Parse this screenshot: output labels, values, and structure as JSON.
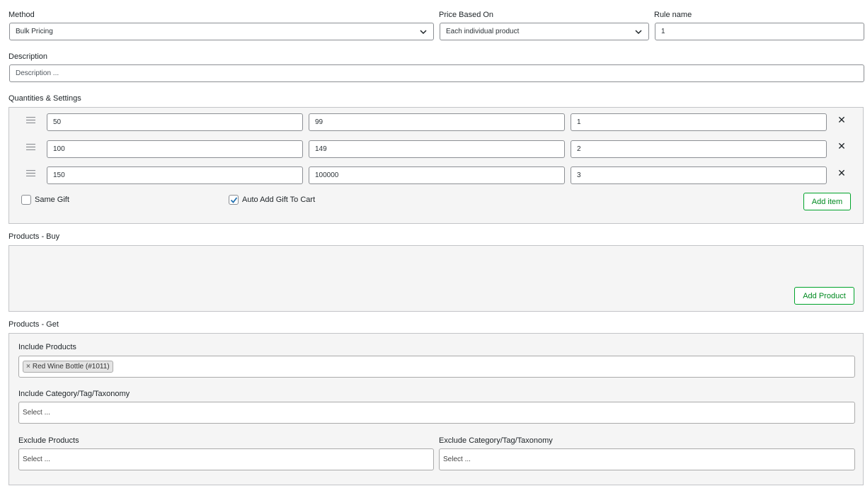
{
  "method": {
    "label": "Method",
    "value": "Bulk Pricing"
  },
  "price_based_on": {
    "label": "Price Based On",
    "value": "Each individual product"
  },
  "rule_name": {
    "label": "Rule name",
    "value": "1"
  },
  "description": {
    "label": "Description",
    "placeholder": "Description ..."
  },
  "quantities": {
    "label": "Quantities & Settings",
    "rows": [
      {
        "min": "50",
        "max": "99",
        "value": "1"
      },
      {
        "min": "100",
        "max": "149",
        "value": "2"
      },
      {
        "min": "150",
        "max": "100000",
        "value": "3"
      }
    ],
    "same_gift": {
      "label": "Same Gift",
      "checked": false
    },
    "auto_add": {
      "label": "Auto Add Gift To Cart",
      "checked": true
    },
    "add_item_label": "Add item"
  },
  "products_buy": {
    "label": "Products - Buy",
    "add_product_label": "Add Product"
  },
  "products_get": {
    "label": "Products - Get",
    "include_products": {
      "label": "Include Products",
      "chips": [
        "Red Wine Bottle (#1011)"
      ]
    },
    "include_category": {
      "label": "Include Category/Tag/Taxonomy",
      "placeholder": "Select ..."
    },
    "exclude_products": {
      "label": "Exclude Products",
      "placeholder": "Select ..."
    },
    "exclude_category": {
      "label": "Exclude Category/Tag/Taxonomy",
      "placeholder": "Select ..."
    }
  },
  "colors": {
    "accent": "#00a32a",
    "panel_bg": "#f5f5f5",
    "border": "#8c8f94"
  }
}
